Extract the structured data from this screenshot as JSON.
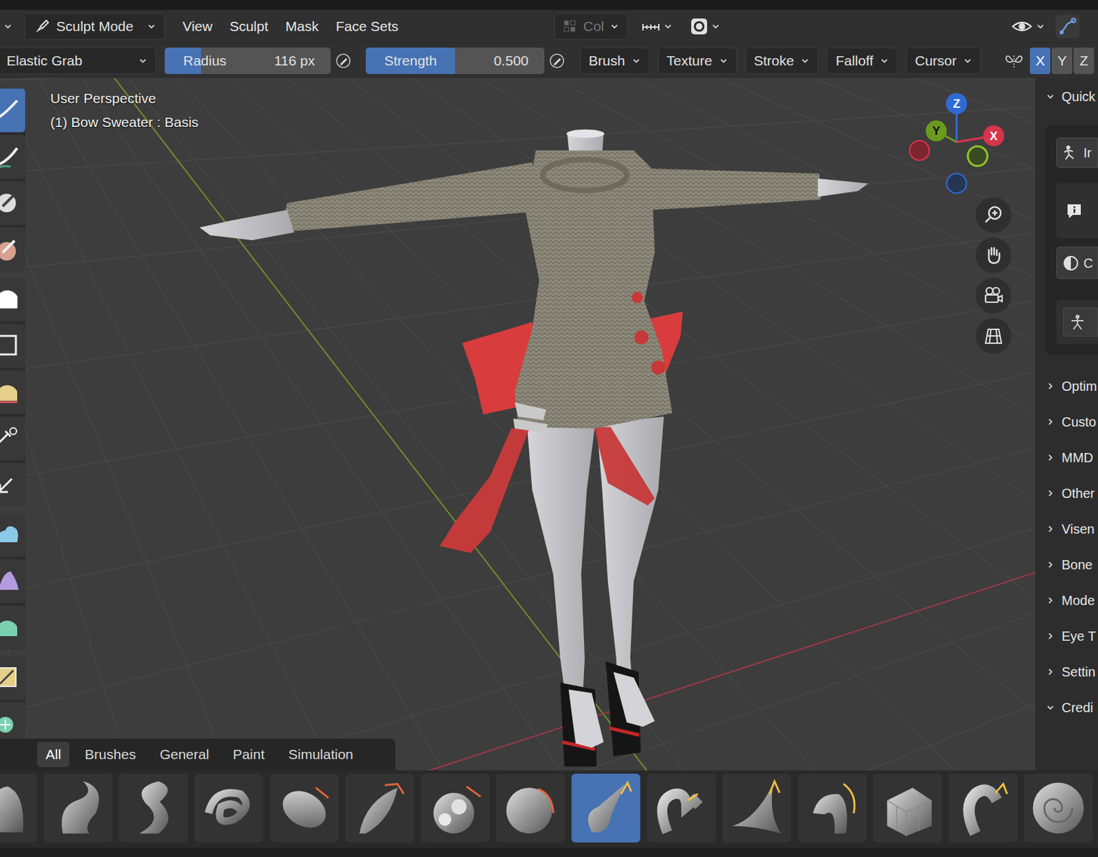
{
  "mode": {
    "label": "Sculpt Mode"
  },
  "menus": [
    "View",
    "Sculpt",
    "Mask",
    "Face Sets"
  ],
  "color_attribute": {
    "label": "Col",
    "disabled": true
  },
  "brush": {
    "name": "Elastic Grab"
  },
  "radius": {
    "label": "Radius",
    "value": "116 px",
    "level": 0.22
  },
  "strength": {
    "label": "Strength",
    "value": "0.500",
    "level": 0.5
  },
  "brush_panels": [
    "Brush",
    "Texture",
    "Stroke",
    "Falloff",
    "Cursor"
  ],
  "symmetry": [
    {
      "label": "X",
      "selected": true
    },
    {
      "label": "Y",
      "selected": false
    },
    {
      "label": "Z",
      "selected": false
    }
  ],
  "viewport": {
    "perspective": "User Perspective",
    "object": "(1) Bow Sweater : Basis",
    "gizmo": {
      "z": "Z",
      "y": "Y",
      "x": "X"
    }
  },
  "toolbar": {
    "groups": [
      [
        {
          "selected": true
        },
        {
          "selected": false
        },
        {
          "selected": false
        },
        {
          "selected": false
        }
      ],
      [
        {
          "selected": false
        },
        {
          "selected": false
        },
        {
          "selected": false
        },
        {
          "selected": false
        },
        {
          "selected": false
        }
      ],
      [
        {
          "selected": false
        },
        {
          "selected": false
        },
        {
          "selected": false
        }
      ],
      [
        {
          "selected": false
        },
        {
          "selected": false
        }
      ]
    ]
  },
  "sidebar": {
    "quick": {
      "label": "Quick",
      "expanded": true,
      "buttons": [
        "Ir",
        "C"
      ]
    },
    "panels": [
      {
        "label": "Optim",
        "expanded": false
      },
      {
        "label": "Custo",
        "expanded": false
      },
      {
        "label": "MMD",
        "expanded": false
      },
      {
        "label": "Other",
        "expanded": false
      },
      {
        "label": "Visen",
        "expanded": false
      },
      {
        "label": "Bone",
        "expanded": false
      },
      {
        "label": "Mode",
        "expanded": false
      },
      {
        "label": "Eye T",
        "expanded": false
      },
      {
        "label": "Settin",
        "expanded": false
      },
      {
        "label": "Credi",
        "expanded": true
      }
    ]
  },
  "asset_shelf": {
    "tabs": [
      {
        "label": "All",
        "selected": true
      },
      {
        "label": "Brushes",
        "selected": false
      },
      {
        "label": "General",
        "selected": false
      },
      {
        "label": "Paint",
        "selected": false
      },
      {
        "label": "Simulation",
        "selected": false
      }
    ],
    "brushes": [
      {
        "selected": false
      },
      {
        "selected": false
      },
      {
        "selected": false
      },
      {
        "selected": false
      },
      {
        "selected": false
      },
      {
        "selected": false
      },
      {
        "selected": false
      },
      {
        "selected": false
      },
      {
        "selected": true
      },
      {
        "selected": false
      },
      {
        "selected": false
      },
      {
        "selected": false
      },
      {
        "selected": false
      },
      {
        "selected": false
      },
      {
        "selected": false
      }
    ]
  }
}
